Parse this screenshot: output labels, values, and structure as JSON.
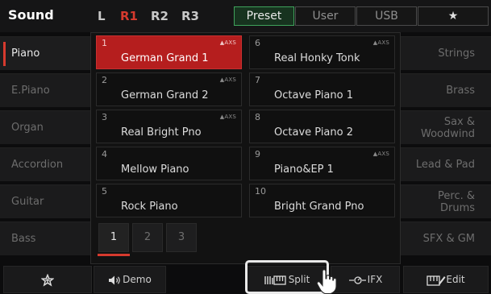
{
  "header": {
    "title": "Sound",
    "layers": [
      {
        "label": "L",
        "active": false
      },
      {
        "label": "R1",
        "active": true
      },
      {
        "label": "R2",
        "active": false
      },
      {
        "label": "R3",
        "active": false
      }
    ],
    "tabs": [
      {
        "label": "Preset",
        "active": true
      },
      {
        "label": "User",
        "active": false
      },
      {
        "label": "USB",
        "active": false
      }
    ],
    "favorite_icon": "star-icon"
  },
  "left_categories": [
    {
      "label": "Piano",
      "active": true
    },
    {
      "label": "E.Piano",
      "active": false
    },
    {
      "label": "Organ",
      "active": false
    },
    {
      "label": "Accordion",
      "active": false
    },
    {
      "label": "Guitar",
      "active": false
    },
    {
      "label": "Bass",
      "active": false
    }
  ],
  "right_categories": [
    {
      "label": "Strings"
    },
    {
      "label": "Brass"
    },
    {
      "label": "Sax & Woodwind",
      "line1": "Sax &",
      "line2": "Woodwind"
    },
    {
      "label": "Lead & Pad"
    },
    {
      "label": "Perc. & Drums",
      "line1": "Perc. &",
      "line2": "Drums"
    },
    {
      "label": "SFX & GM"
    }
  ],
  "voices": [
    {
      "number": "1",
      "name": "German Grand 1",
      "axs": "AXS",
      "selected": true
    },
    {
      "number": "2",
      "name": "German Grand 2",
      "axs": "AXS",
      "selected": false
    },
    {
      "number": "3",
      "name": "Real Bright Pno",
      "axs": "AXS",
      "selected": false
    },
    {
      "number": "4",
      "name": "Mellow Piano",
      "axs": "",
      "selected": false
    },
    {
      "number": "5",
      "name": "Rock Piano",
      "axs": "",
      "selected": false
    },
    {
      "number": "6",
      "name": "Real Honky Tonk",
      "axs": "AXS",
      "selected": false
    },
    {
      "number": "7",
      "name": "Octave Piano 1",
      "axs": "",
      "selected": false
    },
    {
      "number": "8",
      "name": "Octave Piano 2",
      "axs": "",
      "selected": false
    },
    {
      "number": "9",
      "name": "Piano&EP 1",
      "axs": "AXS",
      "selected": false
    },
    {
      "number": "10",
      "name": "Bright Grand Pno",
      "axs": "",
      "selected": false
    }
  ],
  "pages": [
    "1",
    "2",
    "3"
  ],
  "current_page": "1",
  "bottom": {
    "favorite_icon": "star-outline-icon",
    "demo_label": "Demo",
    "split_label": "Split",
    "ifx_label": "IFX",
    "edit_label": "Edit"
  },
  "colors": {
    "accent_red": "#d63a2e",
    "selected_cell": "#b51e1e",
    "active_tab_border": "#3fa35b"
  }
}
